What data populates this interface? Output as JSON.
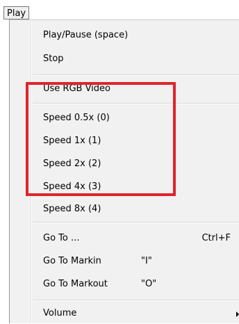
{
  "menubar": {
    "title": "Play"
  },
  "menu": {
    "items": [
      {
        "label": "Play/Pause (space)"
      },
      {
        "label": "Stop"
      },
      {
        "label": "Use RGB Video"
      },
      {
        "label": "Speed 0.5x (0)"
      },
      {
        "label": "Speed 1x (1)"
      },
      {
        "label": "Speed 2x (2)"
      },
      {
        "label": "Speed 4x (3)"
      },
      {
        "label": "Speed 8x (4)"
      },
      {
        "label": "Go To ...",
        "shortcut": "Ctrl+F"
      },
      {
        "label": "Go To Markin",
        "hint": "\"I\""
      },
      {
        "label": "Go To Markout",
        "hint": "\"O\""
      },
      {
        "label": "Volume"
      }
    ]
  },
  "annotation": {
    "highlight_color": "#e0242b"
  }
}
